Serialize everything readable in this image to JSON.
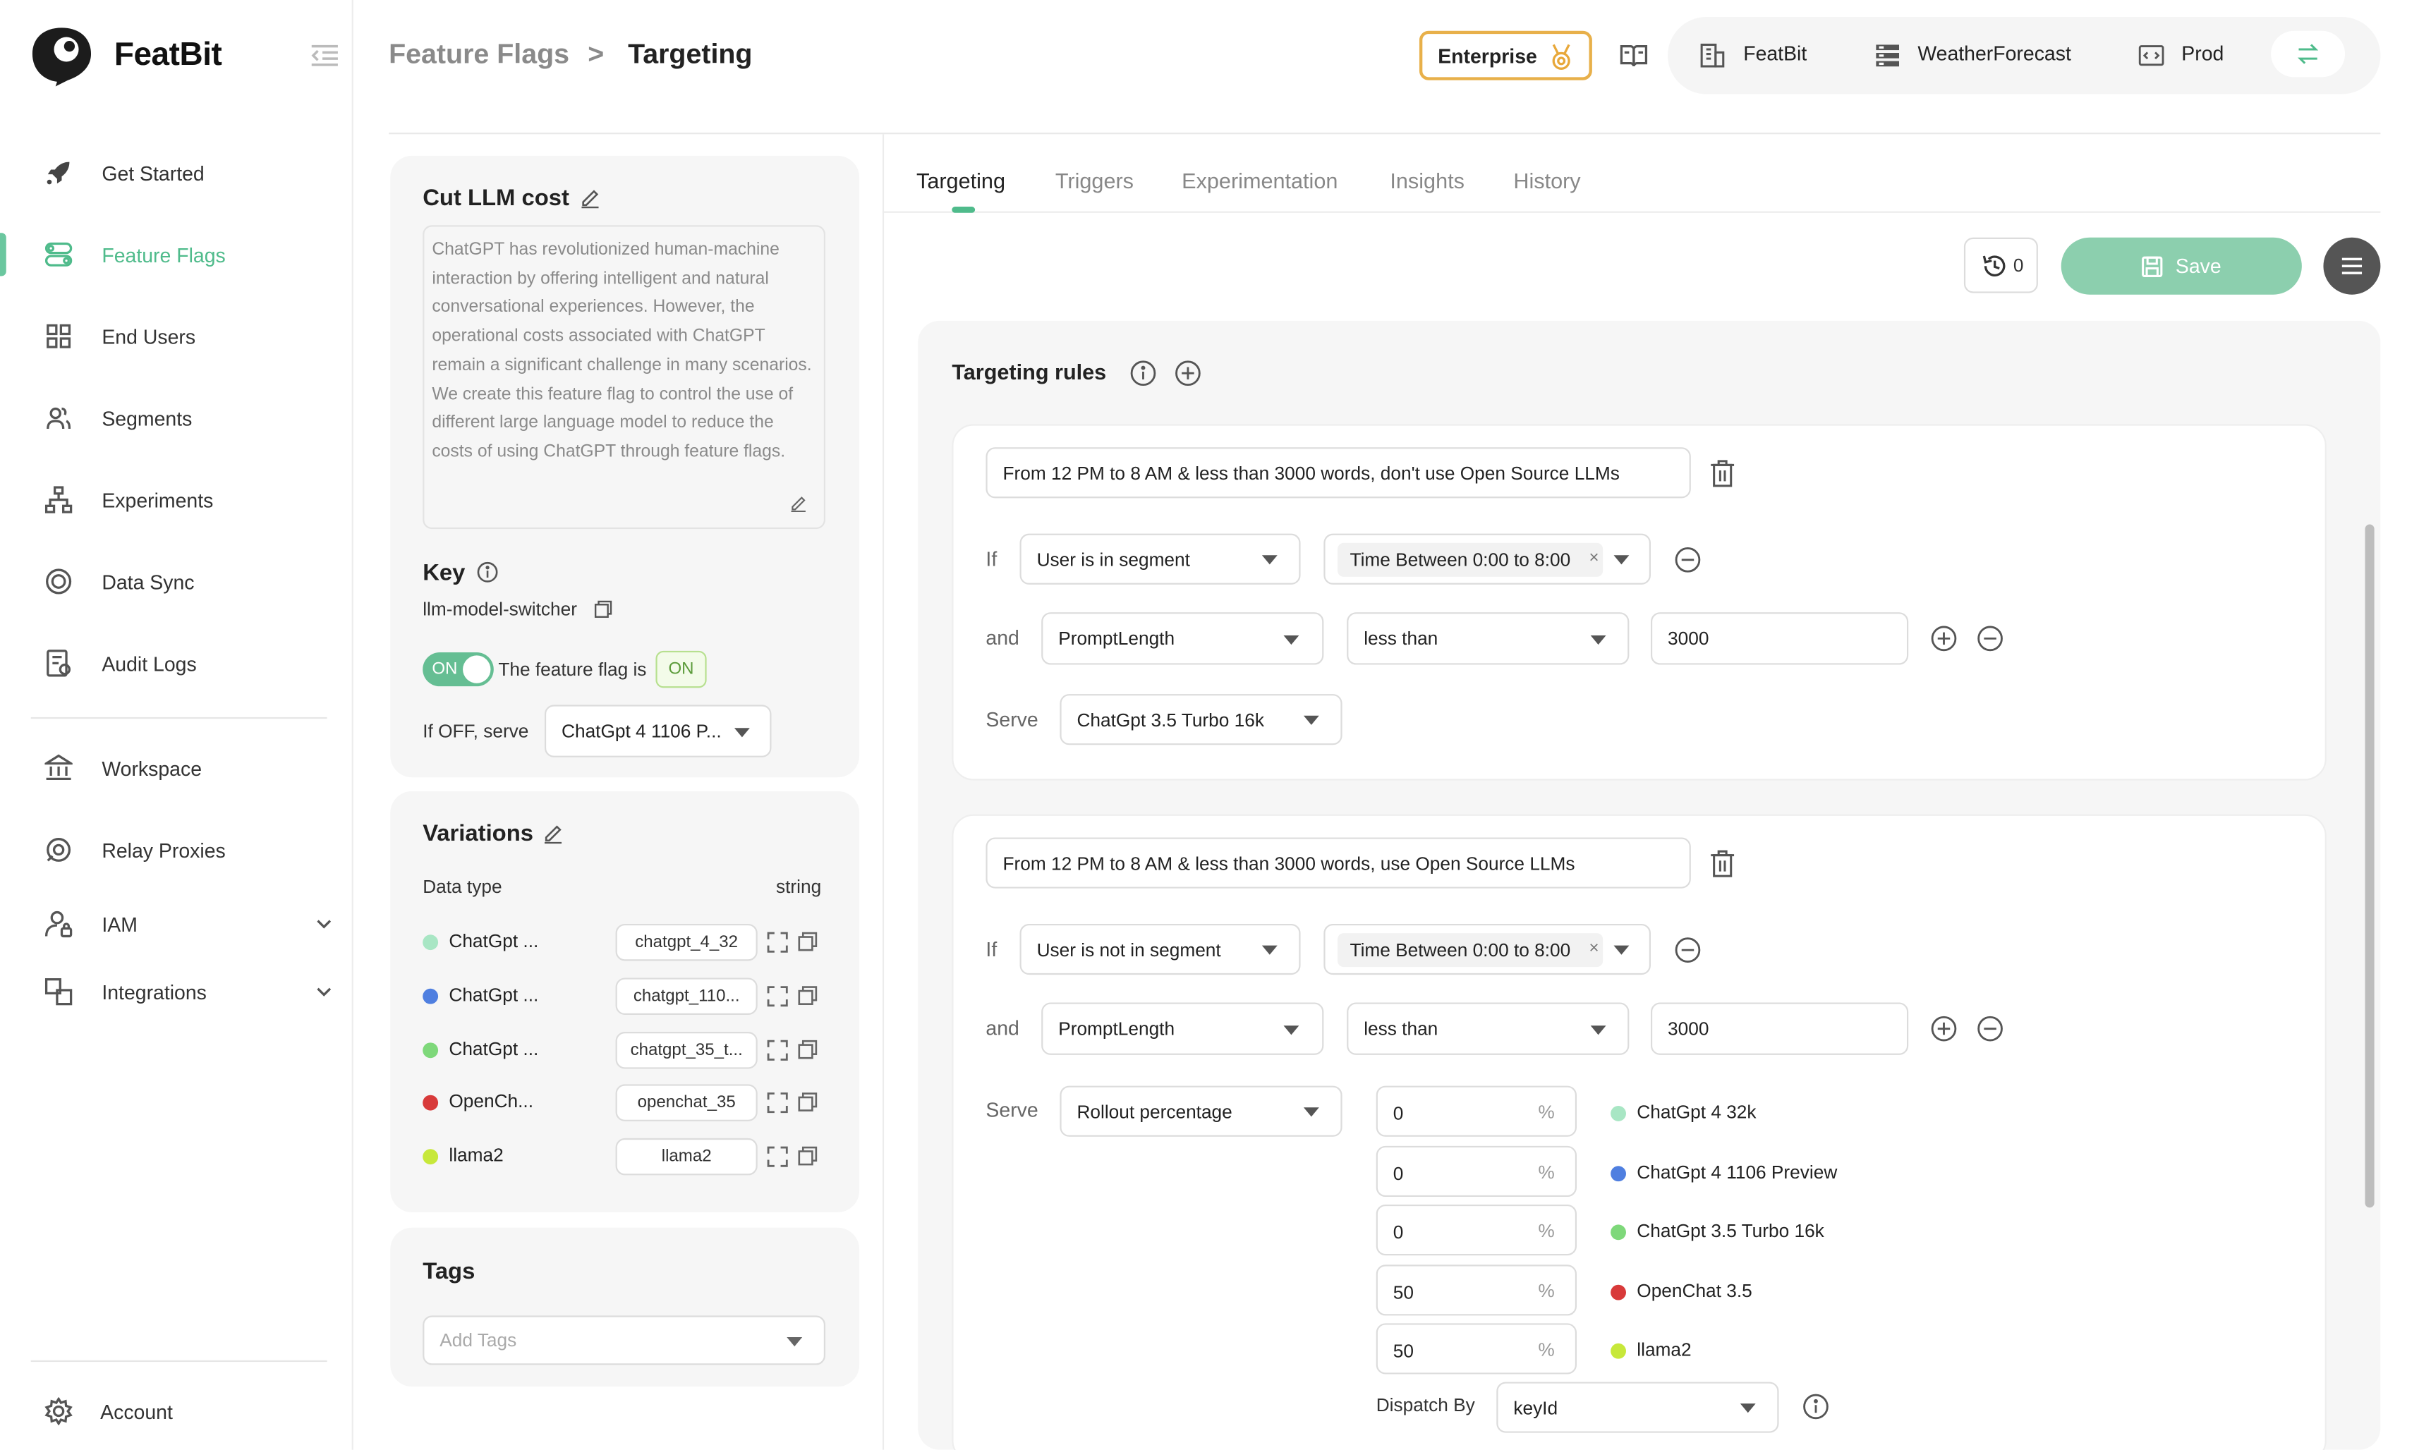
{
  "app": {
    "name": "FeatBit"
  },
  "sidebar": {
    "items": [
      {
        "label": "Get Started",
        "icon": "rocket-icon"
      },
      {
        "label": "Feature Flags",
        "icon": "toggle-icon"
      },
      {
        "label": "End Users",
        "icon": "grid-icon"
      },
      {
        "label": "Segments",
        "icon": "users-icon"
      },
      {
        "label": "Experiments",
        "icon": "hierarchy-icon"
      },
      {
        "label": "Data Sync",
        "icon": "sync-icon"
      },
      {
        "label": "Audit Logs",
        "icon": "log-icon"
      },
      {
        "label": "Workspace",
        "icon": "bank-icon"
      },
      {
        "label": "Relay Proxies",
        "icon": "relay-icon"
      },
      {
        "label": "IAM",
        "icon": "user-lock-icon"
      },
      {
        "label": "Integrations",
        "icon": "integration-icon"
      }
    ],
    "account": "Account"
  },
  "header": {
    "breadcrumb_parent": "Feature Flags",
    "breadcrumb_sep": ">",
    "breadcrumb_current": "Targeting",
    "enterprise_label": "Enterprise",
    "org": "FeatBit",
    "project": "WeatherForecast",
    "env": "Prod"
  },
  "flag": {
    "name": "Cut LLM cost",
    "description": "ChatGPT has revolutionized human-machine interaction by offering intelligent and natural conversational experiences. However, the operational costs associated with ChatGPT remain a significant challenge in many scenarios. We create this feature flag to control the use of different large language model to reduce the costs of using ChatGPT through feature flags.",
    "key_title": "Key",
    "key": "llm-model-switcher",
    "toggle_text": "ON",
    "status_label": "The feature flag is",
    "status_badge": "ON",
    "off_serve_label": "If OFF, serve",
    "off_serve_value": "ChatGpt 4 1106 P..."
  },
  "variations": {
    "title": "Variations",
    "data_type_label": "Data type",
    "data_type": "string",
    "items": [
      {
        "name": "ChatGpt ...",
        "value": "chatgpt_4_32",
        "color": "#a8e6c4"
      },
      {
        "name": "ChatGpt ...",
        "value": "chatgpt_110...",
        "color": "#4f7fe0"
      },
      {
        "name": "ChatGpt ...",
        "value": "chatgpt_35_t...",
        "color": "#7ed87a"
      },
      {
        "name": "OpenCh...",
        "value": "openchat_35",
        "color": "#d83a3a"
      },
      {
        "name": "llama2",
        "value": "llama2",
        "color": "#c7e83a"
      }
    ]
  },
  "tags": {
    "title": "Tags",
    "placeholder": "Add Tags"
  },
  "tabs": [
    "Targeting",
    "Triggers",
    "Experimentation",
    "Insights",
    "History"
  ],
  "toolbar": {
    "history_count": "0",
    "save_label": "Save"
  },
  "targeting": {
    "title": "Targeting rules",
    "rules": [
      {
        "name": "From 12 PM to 8 AM & less than 3000 words, don't use Open Source LLMs",
        "if_label": "If",
        "cond1_op": "User is in segment",
        "cond1_segment": "Time Between 0:00 to 8:00",
        "and_label": "and",
        "cond2_attr": "PromptLength",
        "cond2_op": "less than",
        "cond2_value": "3000",
        "serve_label": "Serve",
        "serve_value": "ChatGpt 3.5 Turbo 16k"
      },
      {
        "name": "From 12 PM to 8 AM & less than 3000 words, use Open Source LLMs",
        "if_label": "If",
        "cond1_op": "User is not in segment",
        "cond1_segment": "Time Between 0:00 to 8:00",
        "and_label": "and",
        "cond2_attr": "PromptLength",
        "cond2_op": "less than",
        "cond2_value": "3000",
        "serve_label": "Serve",
        "serve_value": "Rollout percentage",
        "rollout": [
          {
            "value": "0",
            "name": "ChatGpt 4 32k",
            "color": "#a8e6c4"
          },
          {
            "value": "0",
            "name": "ChatGpt 4 1106 Preview",
            "color": "#4f7fe0"
          },
          {
            "value": "0",
            "name": "ChatGpt 3.5 Turbo 16k",
            "color": "#7ed87a"
          },
          {
            "value": "50",
            "name": "OpenChat 3.5",
            "color": "#d83a3a"
          },
          {
            "value": "50",
            "name": "llama2",
            "color": "#c7e83a"
          }
        ],
        "percent_sign": "%",
        "dispatch_label": "Dispatch By",
        "dispatch_value": "keyId"
      }
    ]
  }
}
